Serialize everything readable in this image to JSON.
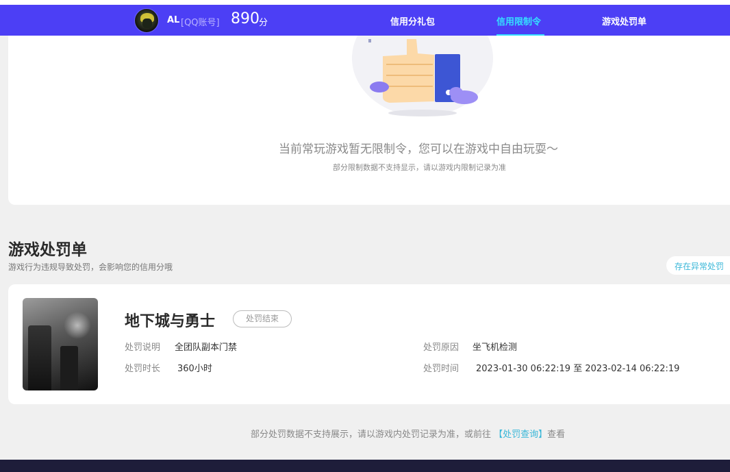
{
  "header": {
    "username": "AL",
    "account_type": "[QQ账号]",
    "score": "890",
    "score_unit": "分",
    "nav": [
      {
        "label": "信用分礼包"
      },
      {
        "label": "信用限制令"
      },
      {
        "label": "游戏处罚单"
      }
    ],
    "active_tab": "信用限制令"
  },
  "restriction": {
    "empty_message": "当前常玩游戏暂无限制令，您可以在游戏中自由玩耍～",
    "empty_note": "部分限制数据不支持显示，请以游戏内限制记录为准"
  },
  "penalty": {
    "title": "游戏处罚单",
    "description": "游戏行为违规导致处罚，会影响您的信用分哦",
    "abnormal_button": "存在异常处罚",
    "item": {
      "game": "地下城与勇士",
      "status": "处罚结束",
      "desc_label": "处罚说明",
      "desc_value": "全团队副本门禁",
      "duration_label": "处罚时长",
      "duration_value": "360小时",
      "reason_label": "处罚原因",
      "reason_value": "坐飞机检测",
      "time_label": "处罚时间",
      "time_value": "2023-01-30 06:22:19 至 2023-02-14 06:22:19"
    },
    "footer_prefix": "部分处罚数据不支持展示，请以游戏内处罚记录为准，或前往",
    "footer_link": "【处罚查询】",
    "footer_suffix": "查看"
  },
  "colors": {
    "nav_bg": "#4c3ff5",
    "accent": "#34e0ff",
    "link": "#3ab7d8"
  }
}
